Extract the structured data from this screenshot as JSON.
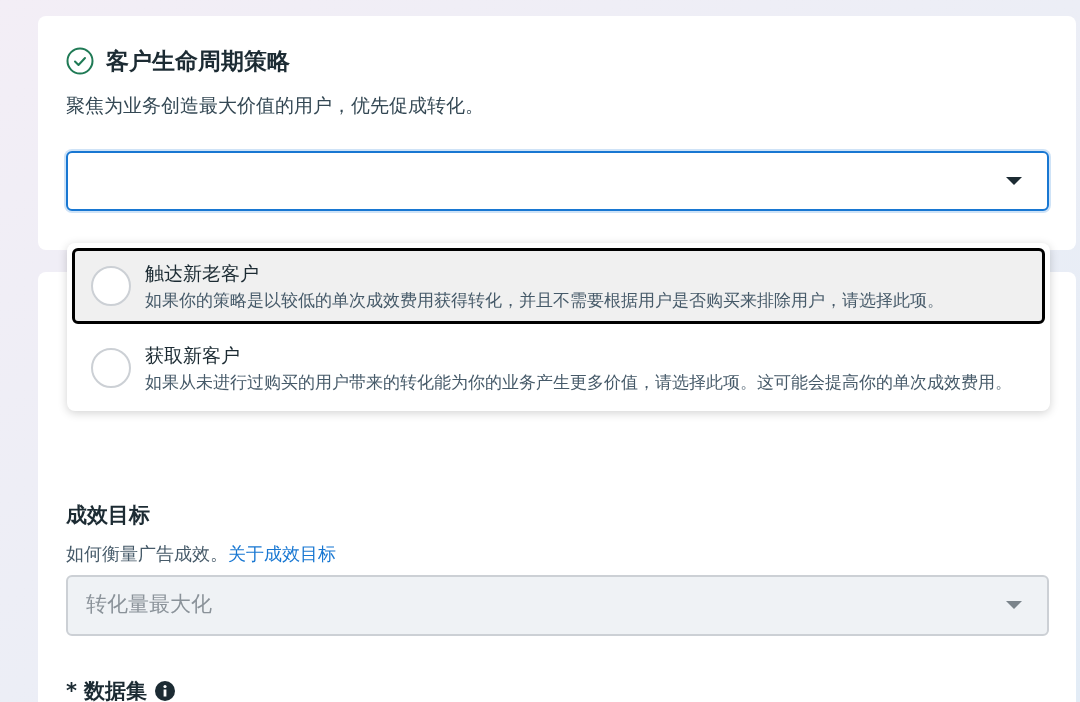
{
  "strategy_card": {
    "title": "客户生命周期策略",
    "done": true,
    "description": "聚焦为业务创造最大价值的用户，优先促成转化。",
    "select": {
      "focused": true,
      "expanded": true
    }
  },
  "dropdown_options": [
    {
      "label": "触达新老客户",
      "description": "如果你的策略是以较低的单次成效费用获得转化，并且不需要根据用户是否购买来排除用户，请选择此项。",
      "highlighted": true,
      "selected": false
    },
    {
      "label": "获取新客户",
      "description": "如果从未进行过购买的用户带来的转化能为你的业务产生更多价值，请选择此项。这可能会提高你的单次成效费用。",
      "highlighted": false,
      "selected": false
    }
  ],
  "goal_card": {
    "heading": "成效目标",
    "help_text": "如何衡量广告成效。",
    "help_link": "关于成效目标",
    "select": {
      "value": "转化量最大化",
      "disabled": true
    },
    "dataset_label": "* 数据集"
  }
}
